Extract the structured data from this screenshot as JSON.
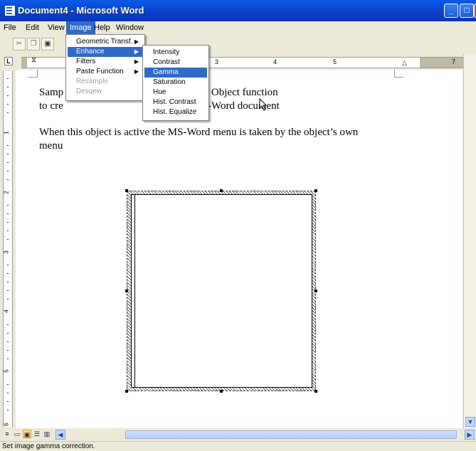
{
  "window": {
    "title": "Document4 - Microsoft Word"
  },
  "menubar": [
    "File",
    "Edit",
    "View",
    "Image",
    "Help",
    "Window"
  ],
  "image_menu": [
    {
      "label": "Geometric Transf.",
      "submenu": true,
      "enabled": true
    },
    {
      "label": "Enhance",
      "submenu": true,
      "enabled": true,
      "highlighted": true
    },
    {
      "label": "Filters",
      "submenu": true,
      "enabled": true
    },
    {
      "label": "Paste Function",
      "submenu": true,
      "enabled": true
    },
    {
      "label": "Resample",
      "submenu": false,
      "enabled": false
    },
    {
      "label": "Desqew",
      "submenu": false,
      "enabled": false
    }
  ],
  "enhance_submenu": [
    {
      "label": "Intensity"
    },
    {
      "label": "Contrast"
    },
    {
      "label": "Gamma",
      "highlighted": true
    },
    {
      "label": "Saturation"
    },
    {
      "label": "Hue"
    },
    {
      "label": "Hist. Contrast"
    },
    {
      "label": "Hist. Equalize"
    }
  ],
  "document": {
    "line1_left": "Samp",
    "line1_right": "t Object function",
    "line2_left": "to cre",
    "line2_right": "-Word document",
    "line3": "When this object is active the MS-Word menu is taken by the object’s own",
    "line4": "menu"
  },
  "ruler": {
    "h_numbers": [
      "3",
      "4",
      "5",
      "7"
    ],
    "v_numbers": [
      "1",
      "2",
      "3",
      "4",
      "5",
      "6"
    ]
  },
  "statusbar": {
    "text": "Set image gamma correction."
  },
  "colors": {
    "titlebar": "#0b3fc6",
    "highlight": "#316ac5",
    "chrome": "#ece9d8"
  }
}
